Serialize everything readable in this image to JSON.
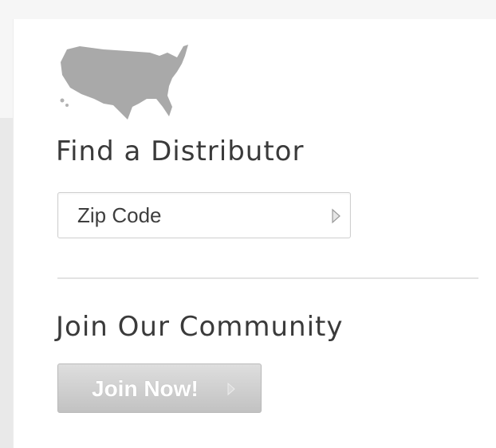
{
  "distributor": {
    "map_icon": "us-map-icon",
    "heading": "Find a Distributor",
    "zip_placeholder": "Zip Code",
    "zip_value": "",
    "submit_icon": "arrow-right-icon"
  },
  "community": {
    "heading": "Join Our Community",
    "button_label": "Join Now!",
    "button_icon": "arrow-right-icon"
  },
  "colors": {
    "map_fill": "#a9a9a9",
    "heading_text": "#3a3a3a",
    "button_fill": "#cfcfcf",
    "button_text": "#ffffff"
  }
}
